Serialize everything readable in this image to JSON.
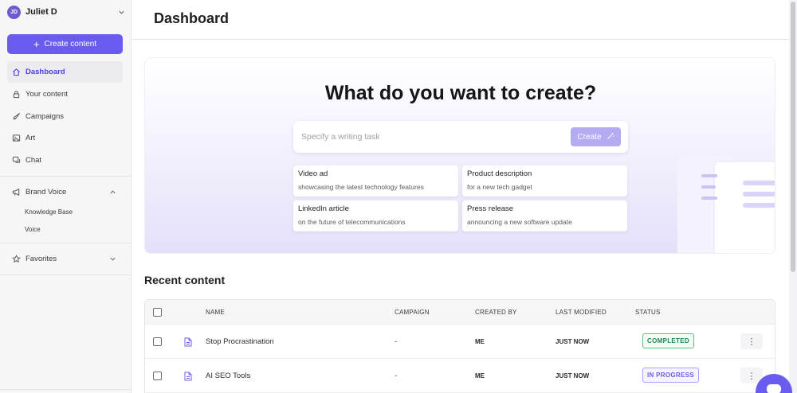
{
  "user": {
    "initials": "JD",
    "name": "Juliet D"
  },
  "sidebar": {
    "create_label": "Create content",
    "items": [
      {
        "label": "Dashboard",
        "icon": "home-icon",
        "active": true
      },
      {
        "label": "Your content",
        "icon": "lock-icon"
      },
      {
        "label": "Campaigns",
        "icon": "rocket-icon"
      },
      {
        "label": "Art",
        "icon": "image-icon"
      },
      {
        "label": "Chat",
        "icon": "chat-icon"
      }
    ],
    "brand_voice": {
      "label": "Brand Voice",
      "icon": "megaphone-icon",
      "sub": [
        "Knowledge Base",
        "Voice"
      ]
    },
    "favorites": {
      "label": "Favorites",
      "icon": "star-icon"
    }
  },
  "header": {
    "title": "Dashboard"
  },
  "hero": {
    "title": "What do you want to create?",
    "placeholder": "Specify a writing task",
    "create_label": "Create",
    "suggestions": [
      {
        "title": "Video ad",
        "sub": "showcasing the latest technology features"
      },
      {
        "title": "Product description",
        "sub": "for a new tech gadget"
      },
      {
        "title": "LinkedIn article",
        "sub": "on the future of telecommunications"
      },
      {
        "title": "Press release",
        "sub": "announcing a new software update"
      }
    ]
  },
  "recent": {
    "title": "Recent content",
    "columns": [
      "NAME",
      "CAMPAIGN",
      "CREATED BY",
      "LAST MODIFIED",
      "STATUS"
    ],
    "rows": [
      {
        "name": "Stop Procrastination",
        "campaign": "-",
        "created_by": "ME",
        "modified": "JUST NOW",
        "status": "COMPLETED",
        "status_color": "#1f8a4a"
      },
      {
        "name": "AI SEO Tools",
        "campaign": "-",
        "created_by": "ME",
        "modified": "JUST NOW",
        "status": "IN PROGRESS",
        "status_color": "#6b5cf0"
      }
    ],
    "more_glyph": "⋮"
  },
  "colors": {
    "accent": "#6b5cf0",
    "accent_light": "#b3acf3",
    "success": "#1f8a4a"
  }
}
